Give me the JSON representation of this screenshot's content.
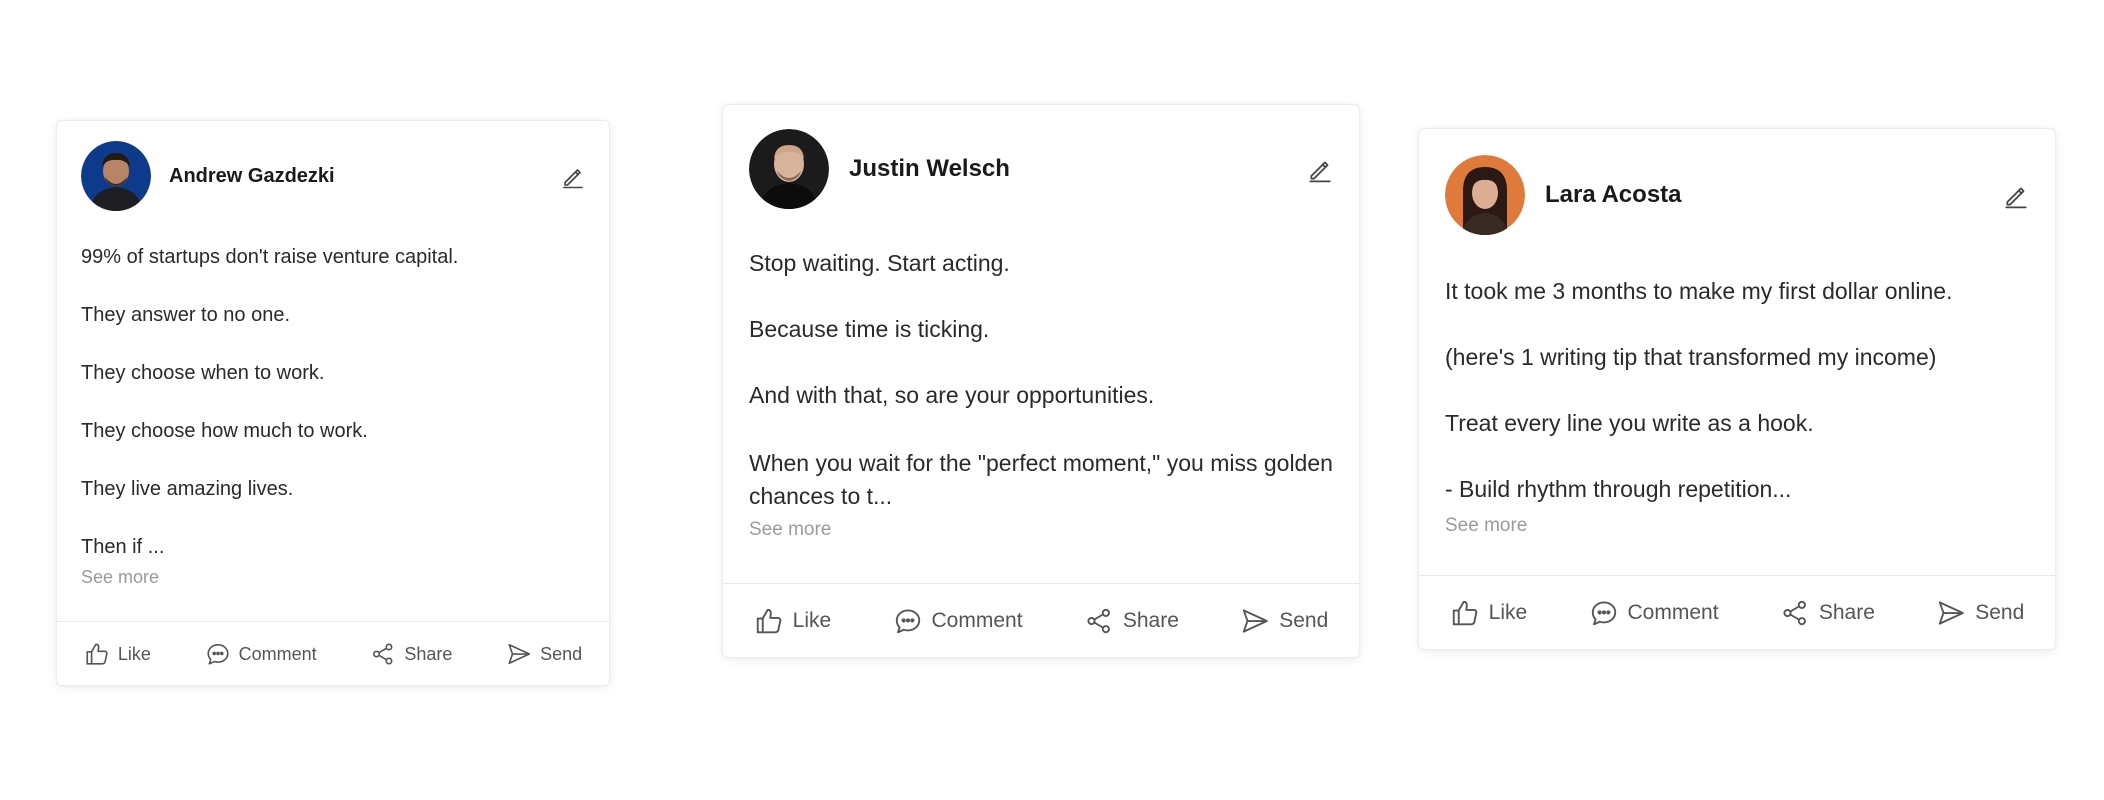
{
  "colors": {
    "text_primary": "#1a1a1a",
    "text_secondary": "#555555",
    "see_more": "#9a9a9a",
    "card_border": "#ececec",
    "avatar_bg_blue": "#0e3a8c",
    "avatar_bg_dark": "#1b1b1b",
    "avatar_bg_orange": "#e07a3a"
  },
  "icons": {
    "edit": "pencil-icon",
    "like": "thumbs-up-icon",
    "comment": "comment-icon",
    "share": "share-icon",
    "send": "send-icon"
  },
  "posts": [
    {
      "author": "Andrew Gazdezki",
      "lines": [
        "99% of startups don't raise venture capital.",
        "They answer to no one.",
        "They choose when to work.",
        "They choose how much to work.",
        "They live amazing lives.",
        "Then if ..."
      ],
      "see_more": "See more",
      "actions": {
        "like": "Like",
        "comment": "Comment",
        "share": "Share",
        "send": "Send"
      }
    },
    {
      "author": "Justin Welsch",
      "lines": [
        "Stop waiting. Start acting.",
        "Because time is ticking.",
        "And with that, so are your opportunities.",
        "When you wait for the \"perfect moment,\" you miss golden chances to t..."
      ],
      "see_more": "See more",
      "actions": {
        "like": "Like",
        "comment": "Comment",
        "share": "Share",
        "send": "Send"
      }
    },
    {
      "author": "Lara Acosta",
      "lines": [
        "It took me 3 months to make my first dollar online.",
        "(here's 1 writing tip that transformed my income)",
        "Treat every line you write as a hook.",
        "- Build rhythm through repetition..."
      ],
      "see_more": "See more",
      "actions": {
        "like": "Like",
        "comment": "Comment",
        "share": "Share",
        "send": "Send"
      }
    }
  ]
}
